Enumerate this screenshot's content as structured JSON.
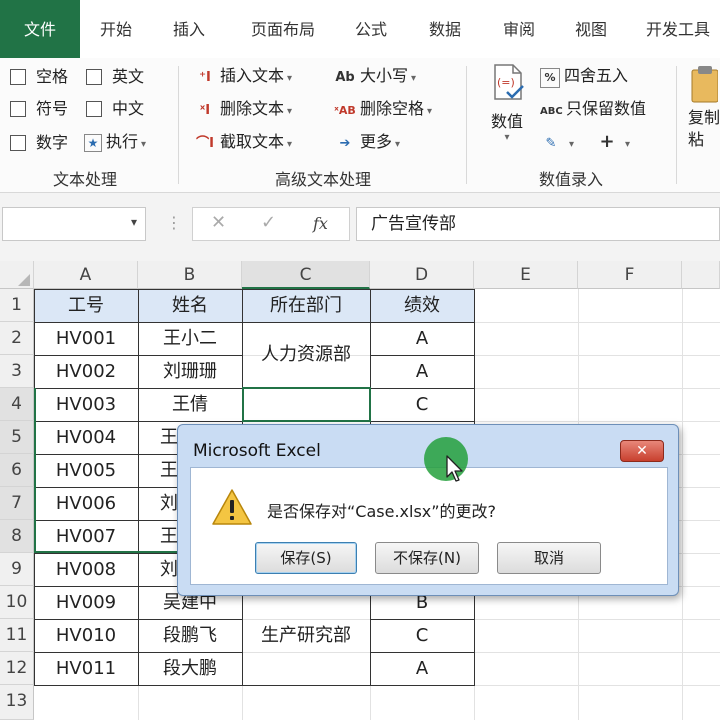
{
  "tabs": [
    {
      "label": "文件",
      "active": true
    },
    {
      "label": "开始"
    },
    {
      "label": "插入"
    },
    {
      "label": "页面布局"
    },
    {
      "label": "公式"
    },
    {
      "label": "数据"
    },
    {
      "label": "审阅"
    },
    {
      "label": "视图"
    },
    {
      "label": "开发工具"
    }
  ],
  "ribbon": {
    "text_group": {
      "label": "文本处理",
      "checkboxes": [
        "空格",
        "英文",
        "符号",
        "中文",
        "数字"
      ],
      "execute_label": "执行"
    },
    "advanced_group": {
      "label": "高级文本处理",
      "buttons": [
        "插入文本",
        "删除文本",
        "截取文本",
        "大小写",
        "删除空格",
        "更多"
      ]
    },
    "entry_group": {
      "label": "数值录入",
      "value_label": "数值",
      "round_label": "四舍五入",
      "keep_value_label": "只保留数值"
    },
    "clipboard": {
      "label_line1": "复制",
      "label_line2": "粘"
    }
  },
  "formula_bar": {
    "name_box": "",
    "formula_value": "广告宣传部",
    "fx_label": "fx"
  },
  "sheet": {
    "columns": [
      "A",
      "B",
      "C",
      "D",
      "E",
      "F"
    ],
    "rows": [
      "1",
      "2",
      "3",
      "4",
      "5",
      "6",
      "7",
      "8",
      "9",
      "10",
      "11",
      "12",
      "13"
    ],
    "headers": [
      "工号",
      "姓名",
      "所在部门",
      "绩效"
    ],
    "ids": [
      "HV001",
      "HV002",
      "HV003",
      "HV004",
      "HV005",
      "HV006",
      "HV007",
      "HV008",
      "HV009",
      "HV010",
      "HV011"
    ],
    "names": [
      "王小二",
      "刘珊珊",
      "王倩",
      "王",
      "王",
      "刘",
      "王",
      "刘",
      "吴建中",
      "段鹏飞",
      "段大鹏"
    ],
    "dept_merged_top": "人力资源部",
    "dept_merged_bottom": "生产研究部",
    "grades": [
      "A",
      "A",
      "C",
      "",
      "",
      "",
      "",
      "",
      "B",
      "C",
      "A"
    ]
  },
  "dialog": {
    "title": "Microsoft Excel",
    "close_label": "✕",
    "message": "是否保存对“Case.xlsx”的更改?",
    "save_label": "保存(S)",
    "dont_save_label": "不保存(N)",
    "cancel_label": "取消"
  },
  "colors": {
    "accent": "#217346",
    "header_fill": "#dbe7f6",
    "dialog_frame": "#c9dcf3",
    "close_red": "#c8402e"
  }
}
